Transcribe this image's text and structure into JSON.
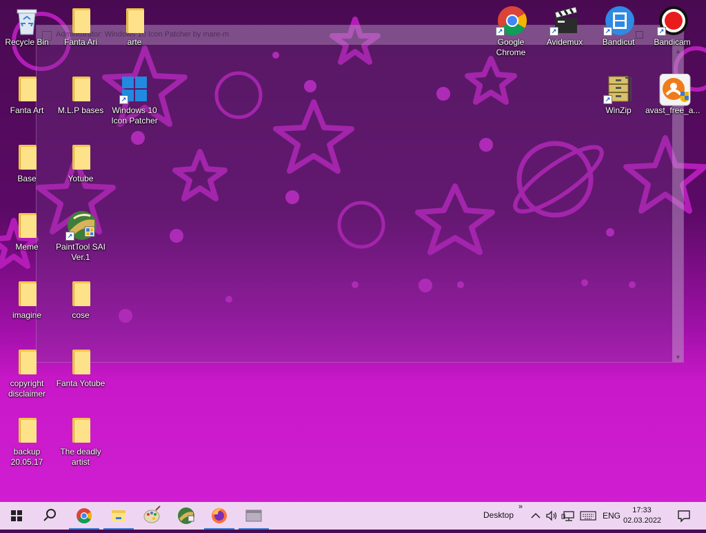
{
  "window": {
    "title": "Administrator: Windows 10 Icon Patcher by mare-m"
  },
  "desktop": {
    "icons_left": [
      {
        "label": "Recycle Bin",
        "icon": "recycle-bin-icon"
      },
      {
        "label": "Fanta Ari",
        "icon": "folder-icon"
      },
      {
        "label": "arte",
        "icon": "folder-icon"
      },
      {
        "label": "Fanta Art",
        "icon": "folder-icon"
      },
      {
        "label": "M.L.P bases",
        "icon": "folder-icon"
      },
      {
        "label": "Windows 10 Icon Patcher",
        "icon": "windows-logo-icon"
      },
      {
        "label": "Base",
        "icon": "folder-icon"
      },
      {
        "label": "Yotube",
        "icon": "folder-icon"
      },
      {
        "label": "Meme",
        "icon": "folder-icon"
      },
      {
        "label": "PaintTool SAI Ver.1",
        "icon": "painttool-sai-icon"
      },
      {
        "label": "imagine",
        "icon": "folder-icon"
      },
      {
        "label": "cose",
        "icon": "folder-icon"
      },
      {
        "label": "copyright disclaimer",
        "icon": "folder-icon"
      },
      {
        "label": "Fanta Yotube",
        "icon": "folder-icon"
      },
      {
        "label": "backup 20.05.17",
        "icon": "folder-icon"
      },
      {
        "label": "The deadly artist",
        "icon": "folder-icon"
      }
    ],
    "icons_right": [
      {
        "label": "Google Chrome",
        "icon": "chrome-icon"
      },
      {
        "label": "Avidemux",
        "icon": "clapperboard-icon"
      },
      {
        "label": "Bandicut",
        "icon": "film-icon"
      },
      {
        "label": "Bandicam",
        "icon": "record-icon"
      },
      {
        "label": "WinZip",
        "icon": "winzip-icon"
      },
      {
        "label": "avast_free_a...",
        "icon": "avast-installer-icon"
      }
    ]
  },
  "taskbar": {
    "pinned": [
      "start-icon",
      "search-icon",
      "chrome-icon",
      "file-explorer-icon",
      "paint-icon",
      "painttool-sai-icon",
      "firefox-icon",
      "window-app-icon"
    ],
    "toolbar_label": "Desktop",
    "toolbar_chevron": "»",
    "language": "ENG",
    "time": "17:33",
    "date": "02.03.2022"
  },
  "colors": {
    "taskbar_bg": "#eed6f2",
    "folder_yellow": "#fde28a",
    "accent": "#3a7bd5"
  }
}
